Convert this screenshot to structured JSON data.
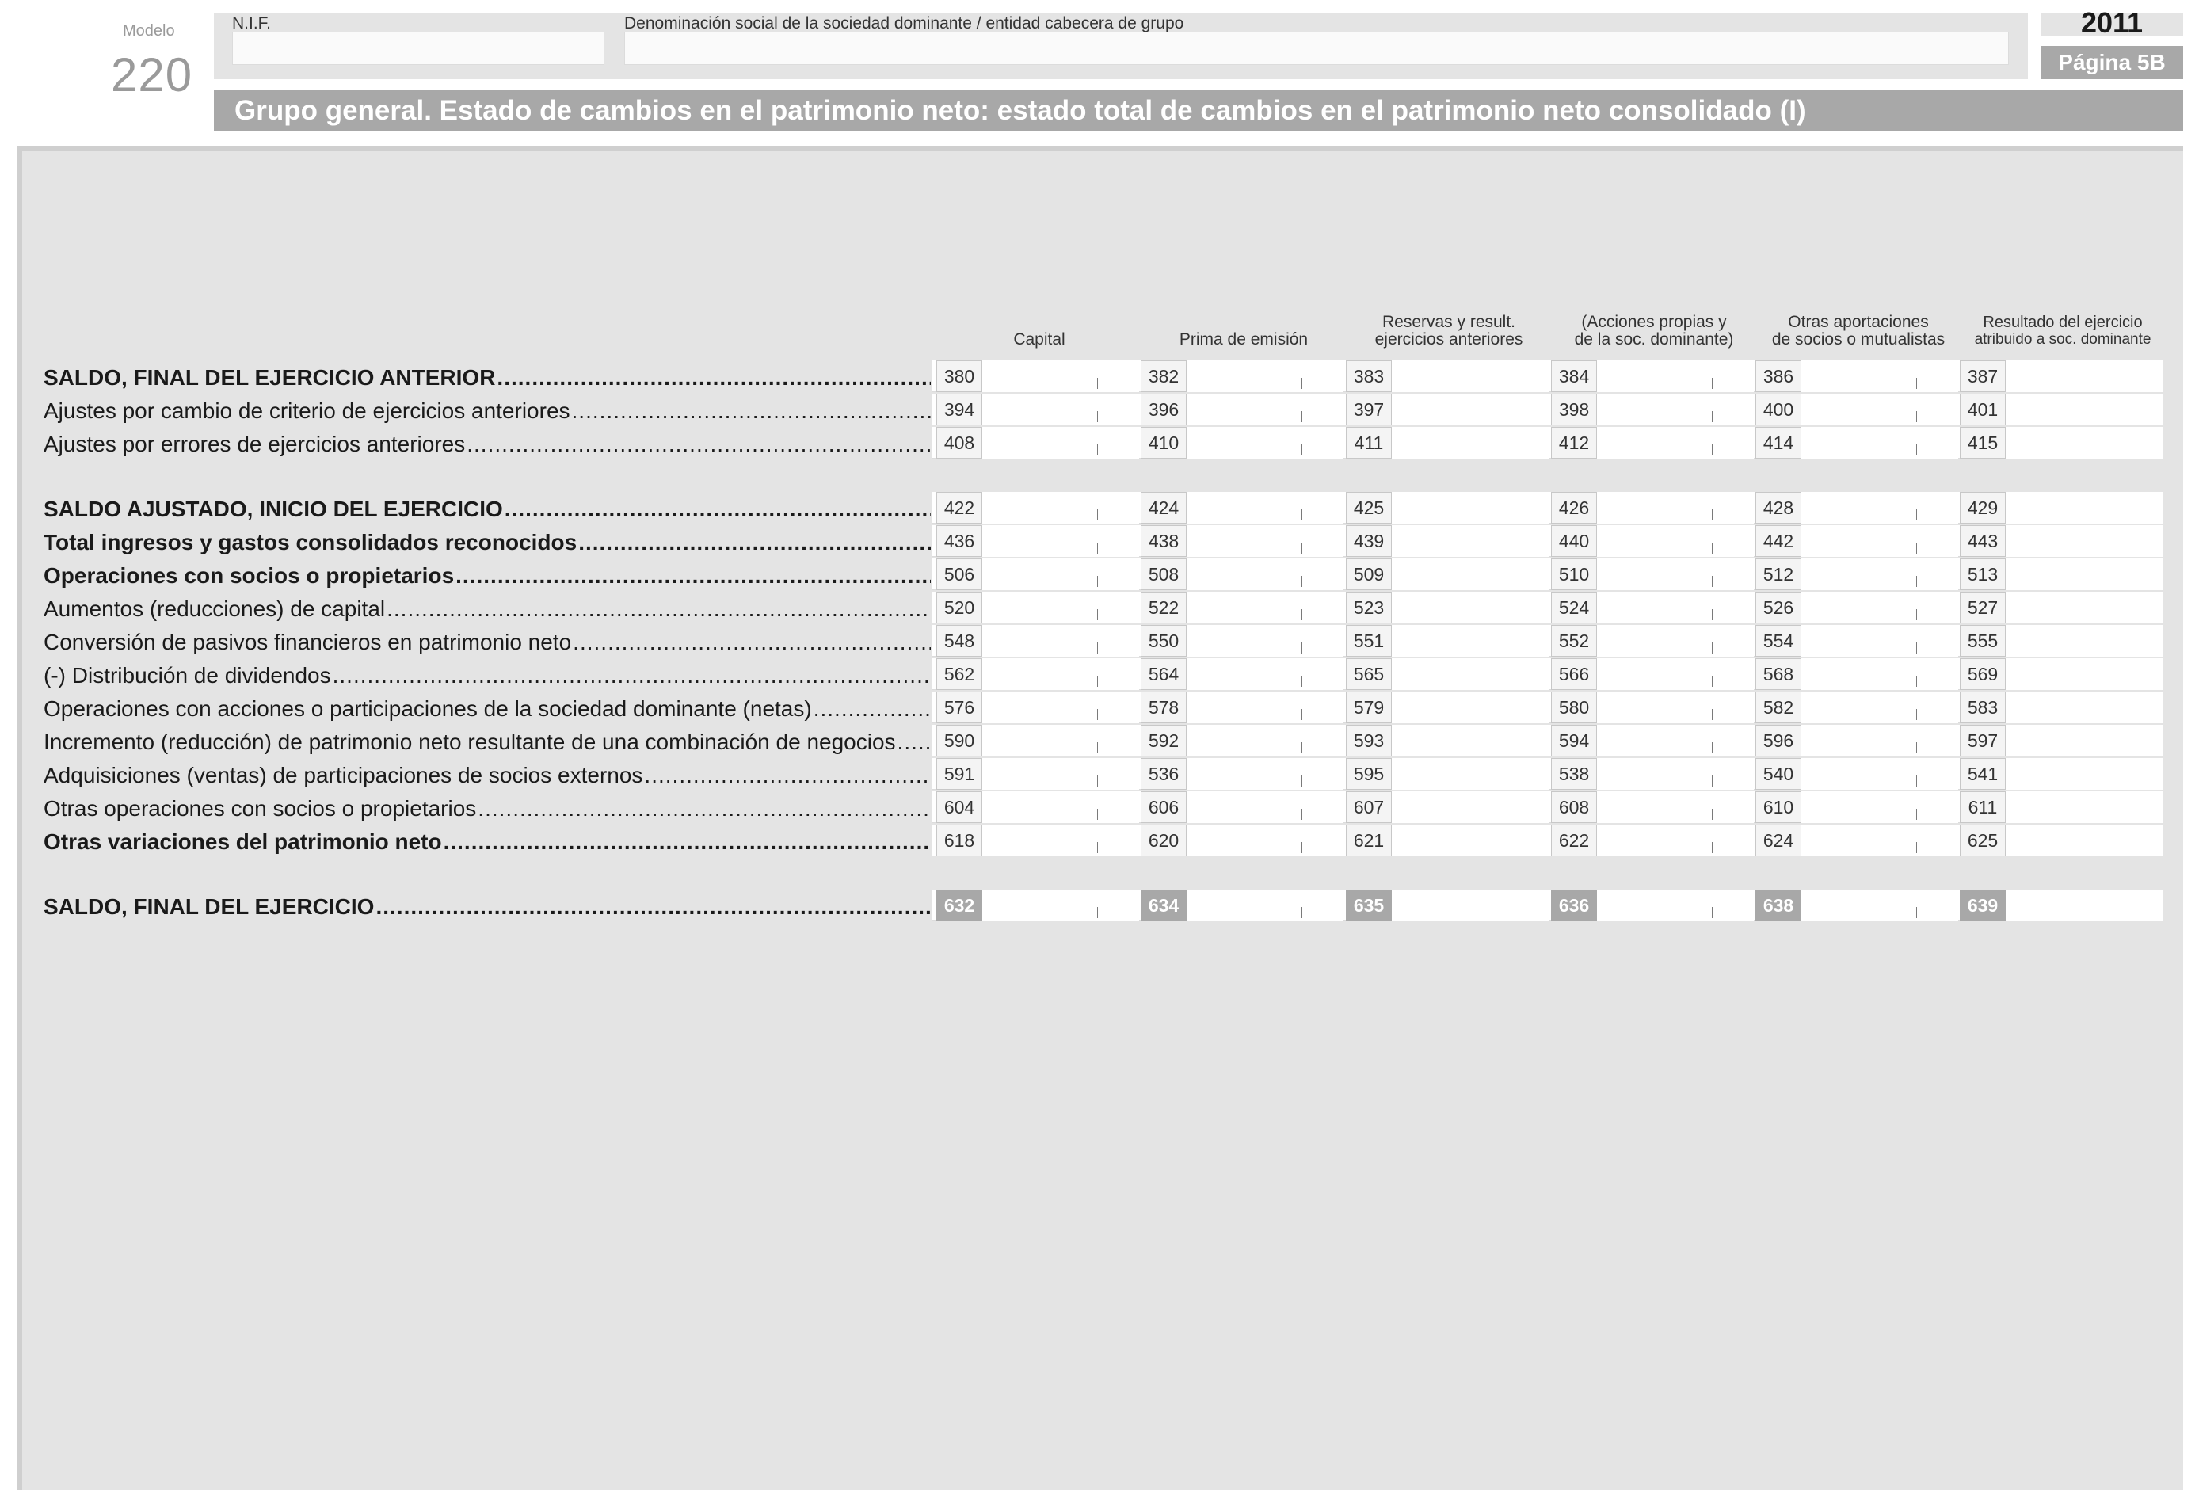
{
  "header": {
    "modelo_label": "Modelo",
    "modelo_number": "220",
    "nif_label": "N.I.F.",
    "nif_value": "",
    "denominacion_label": "Denominación social de la sociedad dominante / entidad cabecera de grupo",
    "denominacion_value": "",
    "year": "2011",
    "page": "Página 5B",
    "title": "Grupo general. Estado de cambios en el patrimonio neto: estado total de cambios en el patrimonio neto consolidado (I)"
  },
  "columns": [
    {
      "line1": "",
      "line2": "Capital",
      "small": false
    },
    {
      "line1": "",
      "line2": "Prima de emisión",
      "small": false
    },
    {
      "line1": "Reservas y result.",
      "line2": "ejercicios anteriores",
      "small": false
    },
    {
      "line1": "(Acciones propias y",
      "line2": "de la soc. dominante)",
      "small": false
    },
    {
      "line1": "Otras aportaciones",
      "line2": "de socios o mutualistas",
      "small": false
    },
    {
      "line1": "Resultado del ejercicio",
      "line2": "atribuido a soc. dominante",
      "small": true
    }
  ],
  "rows": [
    {
      "label": "SALDO, FINAL DEL EJERCICIO ANTERIOR",
      "bold": true,
      "codes": [
        "380",
        "382",
        "383",
        "384",
        "386",
        "387"
      ],
      "values": [
        "",
        "",
        "",
        "",
        "",
        ""
      ]
    },
    {
      "label": "Ajustes por cambio de criterio de ejercicios anteriores",
      "bold": false,
      "codes": [
        "394",
        "396",
        "397",
        "398",
        "400",
        "401"
      ],
      "values": [
        "",
        "",
        "",
        "",
        "",
        ""
      ]
    },
    {
      "label": "Ajustes por errores de ejercicios anteriores",
      "bold": false,
      "codes": [
        "408",
        "410",
        "411",
        "412",
        "414",
        "415"
      ],
      "values": [
        "",
        "",
        "",
        "",
        "",
        ""
      ]
    },
    {
      "label": "SALDO AJUSTADO, INICIO DEL EJERCICIO",
      "bold": true,
      "codes": [
        "422",
        "424",
        "425",
        "426",
        "428",
        "429"
      ],
      "values": [
        "",
        "",
        "",
        "",
        "",
        ""
      ]
    },
    {
      "label": "Total ingresos y gastos consolidados reconocidos",
      "bold": true,
      "codes": [
        "436",
        "438",
        "439",
        "440",
        "442",
        "443"
      ],
      "values": [
        "",
        "",
        "",
        "",
        "",
        ""
      ]
    },
    {
      "label": "Operaciones con socios o propietarios",
      "bold": true,
      "codes": [
        "506",
        "508",
        "509",
        "510",
        "512",
        "513"
      ],
      "values": [
        "",
        "",
        "",
        "",
        "",
        ""
      ]
    },
    {
      "label": "Aumentos (reducciones) de capital",
      "bold": false,
      "codes": [
        "520",
        "522",
        "523",
        "524",
        "526",
        "527"
      ],
      "values": [
        "",
        "",
        "",
        "",
        "",
        ""
      ]
    },
    {
      "label": "Conversión de pasivos financieros en patrimonio neto",
      "bold": false,
      "codes": [
        "548",
        "550",
        "551",
        "552",
        "554",
        "555"
      ],
      "values": [
        "",
        "",
        "",
        "",
        "",
        ""
      ]
    },
    {
      "label": "(-) Distribución de dividendos",
      "bold": false,
      "codes": [
        "562",
        "564",
        "565",
        "566",
        "568",
        "569"
      ],
      "values": [
        "",
        "",
        "",
        "",
        "",
        ""
      ]
    },
    {
      "label": "Operaciones con acciones o participaciones de la sociedad dominante (netas)",
      "bold": false,
      "codes": [
        "576",
        "578",
        "579",
        "580",
        "582",
        "583"
      ],
      "values": [
        "",
        "",
        "",
        "",
        "",
        ""
      ]
    },
    {
      "label": "Incremento (reducción) de patrimonio neto resultante de una combinación de negocios",
      "bold": false,
      "codes": [
        "590",
        "592",
        "593",
        "594",
        "596",
        "597"
      ],
      "values": [
        "",
        "",
        "",
        "",
        "",
        ""
      ]
    },
    {
      "label": "Adquisiciones (ventas) de participaciones de socios externos",
      "bold": false,
      "codes": [
        "591",
        "536",
        "595",
        "538",
        "540",
        "541"
      ],
      "values": [
        "",
        "",
        "",
        "",
        "",
        ""
      ]
    },
    {
      "label": "Otras operaciones con socios o propietarios",
      "bold": false,
      "codes": [
        "604",
        "606",
        "607",
        "608",
        "610",
        "611"
      ],
      "values": [
        "",
        "",
        "",
        "",
        "",
        ""
      ]
    },
    {
      "label": "Otras variaciones del patrimonio neto",
      "bold": true,
      "codes": [
        "618",
        "620",
        "621",
        "622",
        "624",
        "625"
      ],
      "values": [
        "",
        "",
        "",
        "",
        "",
        ""
      ]
    },
    {
      "label": "SALDO, FINAL DEL EJERCICIO",
      "bold": true,
      "dark": true,
      "codes": [
        "632",
        "634",
        "635",
        "636",
        "638",
        "639"
      ],
      "values": [
        "",
        "",
        "",
        "",
        "",
        ""
      ]
    }
  ]
}
